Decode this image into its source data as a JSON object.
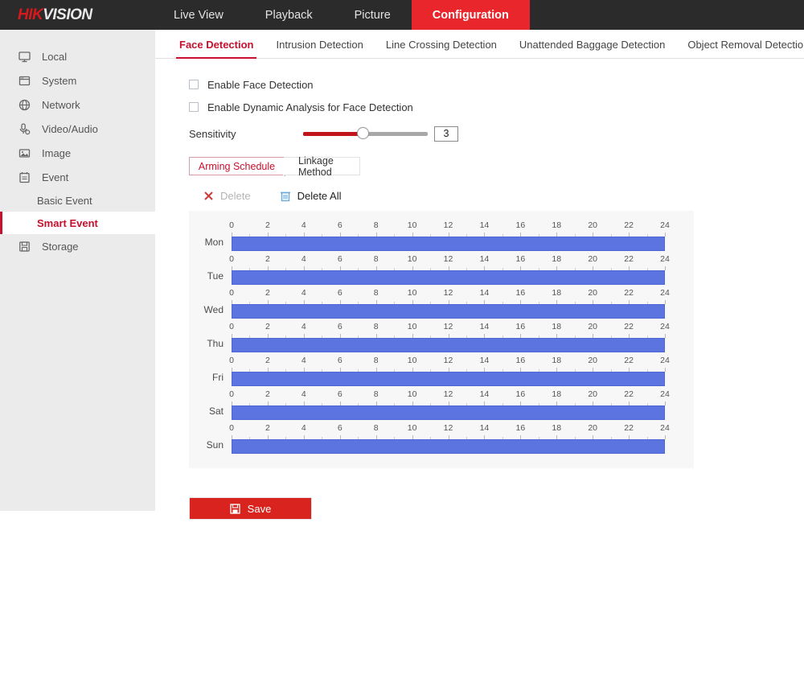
{
  "brand": {
    "part1": "HIK",
    "part2": "VISION"
  },
  "topnav": [
    {
      "label": "Live View",
      "active": false
    },
    {
      "label": "Playback",
      "active": false
    },
    {
      "label": "Picture",
      "active": false
    },
    {
      "label": "Configuration",
      "active": true
    }
  ],
  "sidebar": {
    "items": [
      {
        "label": "Local",
        "icon": "monitor-icon"
      },
      {
        "label": "System",
        "icon": "window-icon"
      },
      {
        "label": "Network",
        "icon": "globe-icon"
      },
      {
        "label": "Video/Audio",
        "icon": "microphone-icon"
      },
      {
        "label": "Image",
        "icon": "picture-icon"
      },
      {
        "label": "Event",
        "icon": "notepad-icon"
      }
    ],
    "sub_items": [
      {
        "label": "Basic Event",
        "active": false
      },
      {
        "label": "Smart Event",
        "active": true
      }
    ],
    "storage": {
      "label": "Storage",
      "icon": "floppy-icon"
    }
  },
  "subtabs": [
    {
      "label": "Face Detection",
      "active": true
    },
    {
      "label": "Intrusion Detection",
      "active": false
    },
    {
      "label": "Line Crossing Detection",
      "active": false
    },
    {
      "label": "Unattended Baggage Detection",
      "active": false
    },
    {
      "label": "Object Removal Detection",
      "active": false
    }
  ],
  "form": {
    "enable_face_detection": "Enable Face Detection",
    "enable_dynamic_analysis": "Enable Dynamic Analysis for Face Detection",
    "sensitivity_label": "Sensitivity",
    "sensitivity_value": "3"
  },
  "schedule_tabs": [
    {
      "label": "Arming Schedule",
      "active": true
    },
    {
      "label": "Linkage Method",
      "active": false
    }
  ],
  "toolbar": {
    "delete_label": "Delete",
    "delete_all_label": "Delete All"
  },
  "schedule": {
    "hour_labels": [
      "0",
      "2",
      "4",
      "6",
      "8",
      "10",
      "12",
      "14",
      "16",
      "18",
      "20",
      "22",
      "24"
    ],
    "days": [
      {
        "label": "Mon",
        "start": 0,
        "end": 24
      },
      {
        "label": "Tue",
        "start": 0,
        "end": 24
      },
      {
        "label": "Wed",
        "start": 0,
        "end": 24
      },
      {
        "label": "Thu",
        "start": 0,
        "end": 24
      },
      {
        "label": "Fri",
        "start": 0,
        "end": 24
      },
      {
        "label": "Sat",
        "start": 0,
        "end": 24
      },
      {
        "label": "Sun",
        "start": 0,
        "end": 24
      }
    ]
  },
  "save": {
    "label": "Save"
  },
  "colors": {
    "brand_red": "#c8102e",
    "accent_red": "#e8262b",
    "schedule_blue": "#5c74e0",
    "header_dark": "#2b2b2b"
  }
}
